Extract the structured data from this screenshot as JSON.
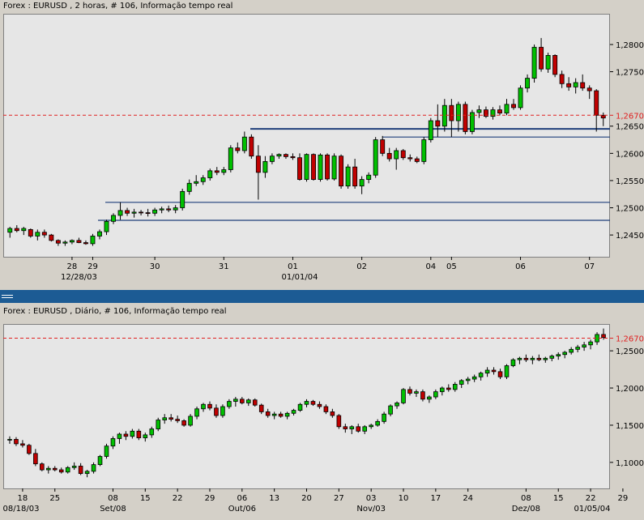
{
  "top": {
    "title": "Forex : EURUSD , 2 horas, # 106, Informação tempo real",
    "last_price_label": "1,2670",
    "price_ticks": [
      {
        "v": 1.245,
        "label": "1,2450"
      },
      {
        "v": 1.25,
        "label": "1,2500"
      },
      {
        "v": 1.255,
        "label": "1,2550"
      },
      {
        "v": 1.26,
        "label": "1,2600"
      },
      {
        "v": 1.265,
        "label": "1,2650"
      },
      {
        "v": 1.275,
        "label": "1,2750"
      },
      {
        "v": 1.28,
        "label": "1,2800"
      }
    ],
    "x_ticks": [
      {
        "i": 9,
        "label": "28"
      },
      {
        "i": 12,
        "label": "29"
      },
      {
        "i": 21,
        "label": "30"
      },
      {
        "i": 31,
        "label": "31"
      },
      {
        "i": 41,
        "label": "01"
      },
      {
        "i": 51,
        "label": "02"
      },
      {
        "i": 61,
        "label": "04"
      },
      {
        "i": 64,
        "label": "05"
      },
      {
        "i": 74,
        "label": "06"
      },
      {
        "i": 84,
        "label": "07"
      }
    ],
    "x_subticks": [
      {
        "i": 10,
        "label": "12/28/03"
      },
      {
        "i": 42,
        "label": "01/01/04"
      }
    ]
  },
  "bottom": {
    "title": "Forex : EURUSD , Diário, # 106, Informação tempo real",
    "last_price_label": "1,2670",
    "price_ticks": [
      {
        "v": 1.1,
        "label": "1,1000"
      },
      {
        "v": 1.15,
        "label": "1,1500"
      },
      {
        "v": 1.2,
        "label": "1,2000"
      },
      {
        "v": 1.25,
        "label": "1,2500"
      }
    ],
    "x_ticks": [
      {
        "i": 2,
        "label": "18"
      },
      {
        "i": 7,
        "label": "25"
      },
      {
        "i": 16,
        "label": "08"
      },
      {
        "i": 21,
        "label": "15"
      },
      {
        "i": 26,
        "label": "22"
      },
      {
        "i": 31,
        "label": "29"
      },
      {
        "i": 36,
        "label": "06"
      },
      {
        "i": 41,
        "label": "13"
      },
      {
        "i": 46,
        "label": "20"
      },
      {
        "i": 51,
        "label": "27"
      },
      {
        "i": 56,
        "label": "03"
      },
      {
        "i": 61,
        "label": "10"
      },
      {
        "i": 66,
        "label": "17"
      },
      {
        "i": 71,
        "label": "24"
      },
      {
        "i": 80,
        "label": "08"
      },
      {
        "i": 85,
        "label": "15"
      },
      {
        "i": 90,
        "label": "22"
      },
      {
        "i": 95,
        "label": "29"
      },
      {
        "i": 100,
        "label": "05"
      }
    ],
    "x_subticks": [
      {
        "i": 0,
        "label": "08/18/03"
      },
      {
        "i": 16,
        "label": "Set/08"
      },
      {
        "i": 36,
        "label": "Out/06"
      },
      {
        "i": 56,
        "label": "Nov/03"
      },
      {
        "i": 80,
        "label": "Dez/08"
      },
      {
        "i": 100,
        "label": "01/05/04"
      }
    ]
  },
  "chart_data": [
    {
      "type": "candlestick",
      "title": "Forex : EURUSD , 2 horas, # 106, Informação tempo real",
      "ylim": [
        1.241,
        1.2855
      ],
      "last_price": 1.267,
      "support_resistance_lines": [
        1.2645,
        1.263,
        1.251,
        1.2477
      ],
      "candles": [
        [
          1.2455,
          1.2465,
          1.2445,
          1.2462
        ],
        [
          1.2462,
          1.2468,
          1.2455,
          1.2458
        ],
        [
          1.2458,
          1.2465,
          1.245,
          1.2462
        ],
        [
          1.246,
          1.2462,
          1.2445,
          1.2448
        ],
        [
          1.2448,
          1.246,
          1.244,
          1.2455
        ],
        [
          1.2455,
          1.246,
          1.2445,
          1.245
        ],
        [
          1.245,
          1.2452,
          1.2438,
          1.244
        ],
        [
          1.244,
          1.2442,
          1.243,
          1.2435
        ],
        [
          1.2435,
          1.244,
          1.243,
          1.2437
        ],
        [
          1.2437,
          1.2442,
          1.2433,
          1.244
        ],
        [
          1.244,
          1.2445,
          1.2435,
          1.2436
        ],
        [
          1.2436,
          1.244,
          1.2432,
          1.2434
        ],
        [
          1.2434,
          1.2452,
          1.243,
          1.2448
        ],
        [
          1.2448,
          1.246,
          1.2442,
          1.2456
        ],
        [
          1.2456,
          1.2478,
          1.245,
          1.2475
        ],
        [
          1.2475,
          1.249,
          1.247,
          1.2486
        ],
        [
          1.2486,
          1.251,
          1.2478,
          1.2495
        ],
        [
          1.2495,
          1.25,
          1.2485,
          1.249
        ],
        [
          1.249,
          1.2498,
          1.2482,
          1.2492
        ],
        [
          1.2492,
          1.2496,
          1.2486,
          1.2491
        ],
        [
          1.2491,
          1.2498,
          1.2484,
          1.249
        ],
        [
          1.249,
          1.25,
          1.2485,
          1.2496
        ],
        [
          1.2496,
          1.2502,
          1.249,
          1.2498
        ],
        [
          1.2498,
          1.2504,
          1.2492,
          1.2496
        ],
        [
          1.2496,
          1.2505,
          1.249,
          1.25
        ],
        [
          1.25,
          1.2535,
          1.2495,
          1.253
        ],
        [
          1.253,
          1.2552,
          1.2524,
          1.2545
        ],
        [
          1.2545,
          1.256,
          1.254,
          1.2548
        ],
        [
          1.2548,
          1.256,
          1.2542,
          1.2555
        ],
        [
          1.2555,
          1.2572,
          1.255,
          1.2568
        ],
        [
          1.2568,
          1.2575,
          1.256,
          1.2565
        ],
        [
          1.2565,
          1.2575,
          1.256,
          1.257
        ],
        [
          1.257,
          1.2615,
          1.2565,
          1.261
        ],
        [
          1.261,
          1.262,
          1.26,
          1.2605
        ],
        [
          1.2605,
          1.264,
          1.26,
          1.263
        ],
        [
          1.263,
          1.2635,
          1.259,
          1.2595
        ],
        [
          1.2595,
          1.2615,
          1.2515,
          1.2565
        ],
        [
          1.2565,
          1.2595,
          1.2555,
          1.2585
        ],
        [
          1.2585,
          1.26,
          1.258,
          1.2595
        ],
        [
          1.2595,
          1.26,
          1.259,
          1.2598
        ],
        [
          1.2598,
          1.26,
          1.259,
          1.2594
        ],
        [
          1.2594,
          1.26,
          1.2588,
          1.2592
        ],
        [
          1.2592,
          1.26,
          1.255,
          1.2552
        ],
        [
          1.2552,
          1.26,
          1.2548,
          1.2598
        ],
        [
          1.2598,
          1.26,
          1.255,
          1.2552
        ],
        [
          1.2552,
          1.26,
          1.2548,
          1.2597
        ],
        [
          1.2597,
          1.26,
          1.255,
          1.2553
        ],
        [
          1.2553,
          1.26,
          1.255,
          1.2595
        ],
        [
          1.2595,
          1.2598,
          1.2535,
          1.254
        ],
        [
          1.254,
          1.258,
          1.2535,
          1.2575
        ],
        [
          1.2575,
          1.259,
          1.2535,
          1.254
        ],
        [
          1.254,
          1.2558,
          1.2525,
          1.2552
        ],
        [
          1.2552,
          1.2565,
          1.2545,
          1.256
        ],
        [
          1.256,
          1.263,
          1.2555,
          1.2625
        ],
        [
          1.2625,
          1.2632,
          1.2595,
          1.26
        ],
        [
          1.26,
          1.261,
          1.2585,
          1.259
        ],
        [
          1.259,
          1.261,
          1.257,
          1.2605
        ],
        [
          1.2605,
          1.2608,
          1.2588,
          1.2592
        ],
        [
          1.2592,
          1.2598,
          1.2585,
          1.259
        ],
        [
          1.259,
          1.2594,
          1.2582,
          1.2585
        ],
        [
          1.2585,
          1.263,
          1.258,
          1.2625
        ],
        [
          1.2625,
          1.2665,
          1.262,
          1.266
        ],
        [
          1.266,
          1.269,
          1.263,
          1.265
        ],
        [
          1.265,
          1.27,
          1.264,
          1.2688
        ],
        [
          1.2688,
          1.27,
          1.263,
          1.266
        ],
        [
          1.266,
          1.2695,
          1.264,
          1.269
        ],
        [
          1.269,
          1.2695,
          1.2635,
          1.264
        ],
        [
          1.264,
          1.268,
          1.2635,
          1.2675
        ],
        [
          1.2675,
          1.2688,
          1.2665,
          1.268
        ],
        [
          1.268,
          1.2686,
          1.2665,
          1.2668
        ],
        [
          1.2668,
          1.2685,
          1.2662,
          1.268
        ],
        [
          1.268,
          1.2688,
          1.267,
          1.2674
        ],
        [
          1.2674,
          1.27,
          1.267,
          1.269
        ],
        [
          1.269,
          1.27,
          1.268,
          1.2684
        ],
        [
          1.2684,
          1.2725,
          1.268,
          1.272
        ],
        [
          1.272,
          1.2745,
          1.2712,
          1.2738
        ],
        [
          1.2738,
          1.28,
          1.273,
          1.2795
        ],
        [
          1.2795,
          1.2812,
          1.275,
          1.2755
        ],
        [
          1.2755,
          1.2785,
          1.2748,
          1.278
        ],
        [
          1.278,
          1.2782,
          1.274,
          1.2745
        ],
        [
          1.2745,
          1.2752,
          1.272,
          1.2728
        ],
        [
          1.2728,
          1.274,
          1.2715,
          1.2722
        ],
        [
          1.2722,
          1.2738,
          1.271,
          1.273
        ],
        [
          1.273,
          1.2745,
          1.2715,
          1.272
        ],
        [
          1.272,
          1.2725,
          1.27,
          1.2715
        ],
        [
          1.2715,
          1.2718,
          1.264,
          1.267
        ],
        [
          1.267,
          1.2675,
          1.265,
          1.2665
        ]
      ]
    },
    {
      "type": "candlestick",
      "title": "Forex : EURUSD , Diário, # 106, Informação tempo real",
      "ylim": [
        1.065,
        1.285
      ],
      "last_price": 1.267,
      "candles": [
        [
          1.13,
          1.135,
          1.125,
          1.131
        ],
        [
          1.131,
          1.134,
          1.122,
          1.125
        ],
        [
          1.125,
          1.13,
          1.12,
          1.123
        ],
        [
          1.123,
          1.125,
          1.11,
          1.112
        ],
        [
          1.112,
          1.118,
          1.095,
          1.098
        ],
        [
          1.098,
          1.1,
          1.088,
          1.09
        ],
        [
          1.09,
          1.095,
          1.085,
          1.092
        ],
        [
          1.092,
          1.095,
          1.088,
          1.09
        ],
        [
          1.09,
          1.093,
          1.085,
          1.087
        ],
        [
          1.087,
          1.095,
          1.085,
          1.093
        ],
        [
          1.093,
          1.1,
          1.09,
          1.095
        ],
        [
          1.095,
          1.099,
          1.083,
          1.085
        ],
        [
          1.085,
          1.09,
          1.08,
          1.088
        ],
        [
          1.088,
          1.1,
          1.085,
          1.097
        ],
        [
          1.097,
          1.11,
          1.095,
          1.108
        ],
        [
          1.108,
          1.125,
          1.105,
          1.122
        ],
        [
          1.122,
          1.135,
          1.118,
          1.132
        ],
        [
          1.132,
          1.14,
          1.125,
          1.138
        ],
        [
          1.138,
          1.142,
          1.13,
          1.135
        ],
        [
          1.135,
          1.145,
          1.132,
          1.142
        ],
        [
          1.142,
          1.145,
          1.13,
          1.133
        ],
        [
          1.133,
          1.14,
          1.128,
          1.137
        ],
        [
          1.137,
          1.148,
          1.133,
          1.145
        ],
        [
          1.145,
          1.16,
          1.142,
          1.157
        ],
        [
          1.157,
          1.165,
          1.152,
          1.16
        ],
        [
          1.16,
          1.165,
          1.155,
          1.158
        ],
        [
          1.158,
          1.163,
          1.153,
          1.156
        ],
        [
          1.156,
          1.158,
          1.148,
          1.15
        ],
        [
          1.15,
          1.165,
          1.148,
          1.162
        ],
        [
          1.162,
          1.175,
          1.158,
          1.172
        ],
        [
          1.172,
          1.18,
          1.168,
          1.178
        ],
        [
          1.178,
          1.182,
          1.17,
          1.173
        ],
        [
          1.173,
          1.178,
          1.16,
          1.163
        ],
        [
          1.163,
          1.178,
          1.16,
          1.175
        ],
        [
          1.175,
          1.185,
          1.172,
          1.182
        ],
        [
          1.182,
          1.188,
          1.175,
          1.185
        ],
        [
          1.185,
          1.188,
          1.178,
          1.18
        ],
        [
          1.18,
          1.186,
          1.176,
          1.184
        ],
        [
          1.184,
          1.186,
          1.175,
          1.177
        ],
        [
          1.177,
          1.179,
          1.165,
          1.168
        ],
        [
          1.168,
          1.172,
          1.16,
          1.163
        ],
        [
          1.163,
          1.168,
          1.158,
          1.165
        ],
        [
          1.165,
          1.168,
          1.16,
          1.162
        ],
        [
          1.162,
          1.168,
          1.158,
          1.166
        ],
        [
          1.166,
          1.172,
          1.163,
          1.17
        ],
        [
          1.17,
          1.18,
          1.168,
          1.178
        ],
        [
          1.178,
          1.185,
          1.174,
          1.182
        ],
        [
          1.182,
          1.184,
          1.176,
          1.178
        ],
        [
          1.178,
          1.182,
          1.172,
          1.175
        ],
        [
          1.175,
          1.178,
          1.165,
          1.168
        ],
        [
          1.168,
          1.172,
          1.16,
          1.163
        ],
        [
          1.163,
          1.165,
          1.145,
          1.148
        ],
        [
          1.148,
          1.152,
          1.14,
          1.145
        ],
        [
          1.145,
          1.15,
          1.138,
          1.148
        ],
        [
          1.148,
          1.152,
          1.14,
          1.142
        ],
        [
          1.142,
          1.15,
          1.138,
          1.148
        ],
        [
          1.148,
          1.152,
          1.145,
          1.15
        ],
        [
          1.15,
          1.158,
          1.148,
          1.155
        ],
        [
          1.155,
          1.168,
          1.152,
          1.165
        ],
        [
          1.165,
          1.178,
          1.162,
          1.176
        ],
        [
          1.176,
          1.182,
          1.172,
          1.18
        ],
        [
          1.18,
          1.2,
          1.178,
          1.198
        ],
        [
          1.198,
          1.202,
          1.19,
          1.193
        ],
        [
          1.193,
          1.198,
          1.188,
          1.195
        ],
        [
          1.195,
          1.198,
          1.182,
          1.185
        ],
        [
          1.185,
          1.19,
          1.18,
          1.188
        ],
        [
          1.188,
          1.198,
          1.185,
          1.195
        ],
        [
          1.195,
          1.202,
          1.19,
          1.2
        ],
        [
          1.2,
          1.205,
          1.195,
          1.198
        ],
        [
          1.198,
          1.208,
          1.195,
          1.205
        ],
        [
          1.205,
          1.212,
          1.2,
          1.21
        ],
        [
          1.21,
          1.215,
          1.205,
          1.212
        ],
        [
          1.212,
          1.218,
          1.208,
          1.215
        ],
        [
          1.215,
          1.222,
          1.21,
          1.22
        ],
        [
          1.22,
          1.228,
          1.215,
          1.224
        ],
        [
          1.224,
          1.228,
          1.218,
          1.222
        ],
        [
          1.222,
          1.226,
          1.212,
          1.215
        ],
        [
          1.215,
          1.232,
          1.212,
          1.23
        ],
        [
          1.23,
          1.24,
          1.228,
          1.238
        ],
        [
          1.238,
          1.242,
          1.232,
          1.24
        ],
        [
          1.24,
          1.245,
          1.235,
          1.238
        ],
        [
          1.238,
          1.243,
          1.232,
          1.24
        ],
        [
          1.24,
          1.245,
          1.236,
          1.238
        ],
        [
          1.238,
          1.242,
          1.234,
          1.24
        ],
        [
          1.24,
          1.245,
          1.236,
          1.243
        ],
        [
          1.243,
          1.248,
          1.238,
          1.245
        ],
        [
          1.245,
          1.25,
          1.24,
          1.248
        ],
        [
          1.248,
          1.255,
          1.245,
          1.252
        ],
        [
          1.252,
          1.258,
          1.248,
          1.255
        ],
        [
          1.255,
          1.262,
          1.25,
          1.258
        ],
        [
          1.258,
          1.265,
          1.252,
          1.262
        ],
        [
          1.262,
          1.275,
          1.258,
          1.272
        ],
        [
          1.272,
          1.28,
          1.265,
          1.268
        ]
      ]
    }
  ]
}
